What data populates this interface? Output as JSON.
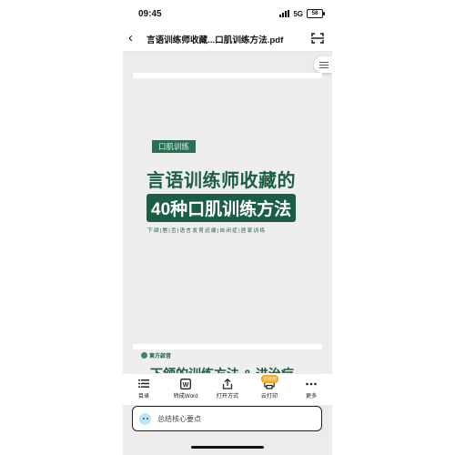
{
  "status_bar": {
    "time": "09:45",
    "network": "5G",
    "battery": "58"
  },
  "nav": {
    "back_icon": "chevron-left-icon",
    "title": "言语训练师收藏...口肌训练方法.pdf",
    "scan_icon": "scan-icon"
  },
  "document": {
    "page1": {
      "tag": "口肌训练",
      "headline": "言语训练师收藏的",
      "subhead": "40种口肌训练方法",
      "subtitle": "下颌|唇|舌|语言发育迟缓|自闭症|居家训练"
    },
    "page2": {
      "brand": "東方啟音",
      "peek_text": "下颌的训练方法 & 进治疗"
    }
  },
  "toolbar": {
    "items": [
      {
        "label": "目录",
        "icon": "list-icon"
      },
      {
        "label": "转成Word",
        "icon": "word-icon"
      },
      {
        "label": "打开方式",
        "icon": "share-icon"
      },
      {
        "label": "云打印",
        "icon": "print-icon",
        "badge": "去使用"
      },
      {
        "label": "更多",
        "icon": "more-icon"
      }
    ]
  },
  "summary": {
    "text": "总结核心要点",
    "icon": "ai-assistant-icon"
  },
  "colors": {
    "brand_green": "#1c5e44",
    "tag_green": "#2b6f52",
    "badge_orange": "#f5a623"
  }
}
